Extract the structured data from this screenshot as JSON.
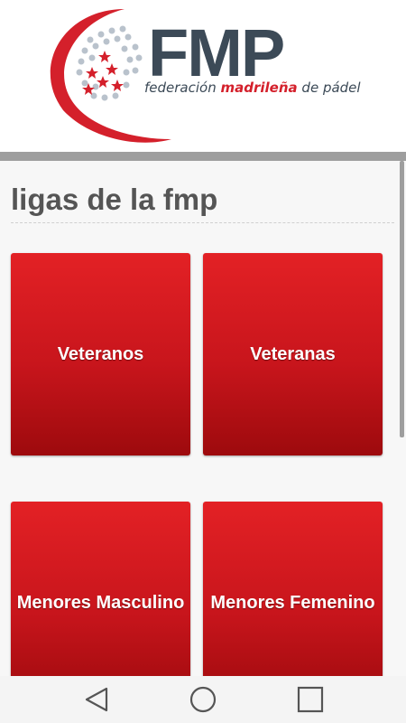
{
  "header": {
    "logo": {
      "name": "fmp-logo",
      "acronym": "FMP",
      "tagline_part1": "federación ",
      "tagline_accent": "madrileña",
      "tagline_part2": " de pádel"
    }
  },
  "page": {
    "title": "ligas de la fmp"
  },
  "leagues": [
    {
      "label": "Veteranos"
    },
    {
      "label": "Veteranas"
    },
    {
      "label": "Menores Masculino"
    },
    {
      "label": "Menores Femenino"
    }
  ],
  "colors": {
    "brand_red": "#d4202b",
    "brand_slate": "#3c4a57",
    "button_gradient_top": "#e32125",
    "button_gradient_bottom": "#9d0a0d"
  },
  "navbar": {
    "icons": [
      "back-icon",
      "home-icon",
      "recents-icon"
    ]
  }
}
